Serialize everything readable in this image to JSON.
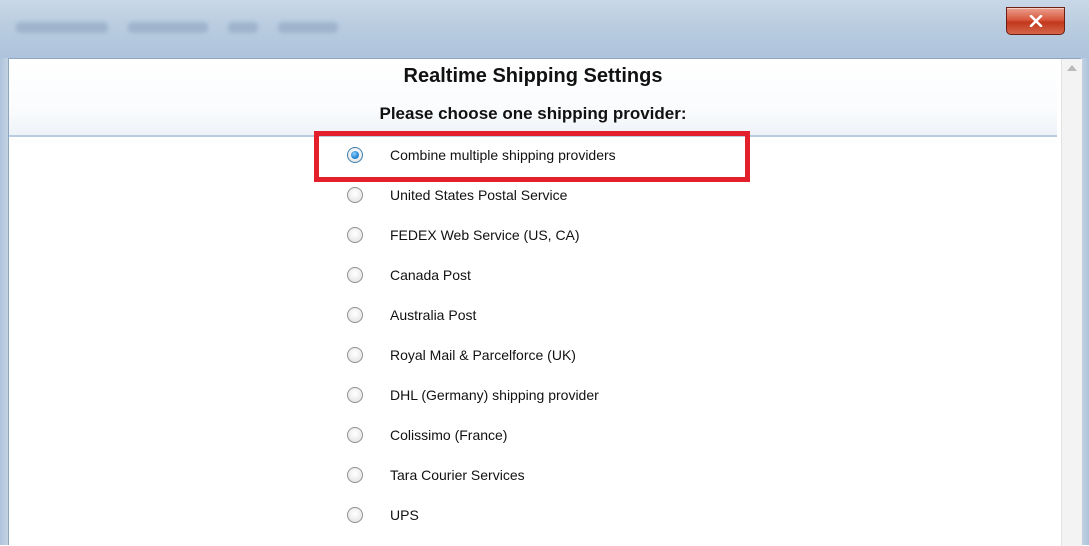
{
  "window": {
    "close_glyph": "✕"
  },
  "dialog": {
    "title": "Realtime Shipping Settings",
    "subtitle": "Please choose one shipping provider:"
  },
  "providers": [
    {
      "label": "Combine multiple shipping providers",
      "selected": true
    },
    {
      "label": "United States Postal Service",
      "selected": false
    },
    {
      "label": "FEDEX Web Service (US, CA)",
      "selected": false
    },
    {
      "label": "Canada Post",
      "selected": false
    },
    {
      "label": "Australia Post",
      "selected": false
    },
    {
      "label": "Royal Mail & Parcelforce (UK)",
      "selected": false
    },
    {
      "label": "DHL (Germany) shipping provider",
      "selected": false
    },
    {
      "label": "Colissimo (France)",
      "selected": false
    },
    {
      "label": "Tara Courier Services",
      "selected": false
    },
    {
      "label": "UPS",
      "selected": false
    }
  ],
  "colors": {
    "highlight_box": "#e21f2b",
    "radio_selected": "#2a8ad6",
    "close_button": "#c2381d"
  }
}
